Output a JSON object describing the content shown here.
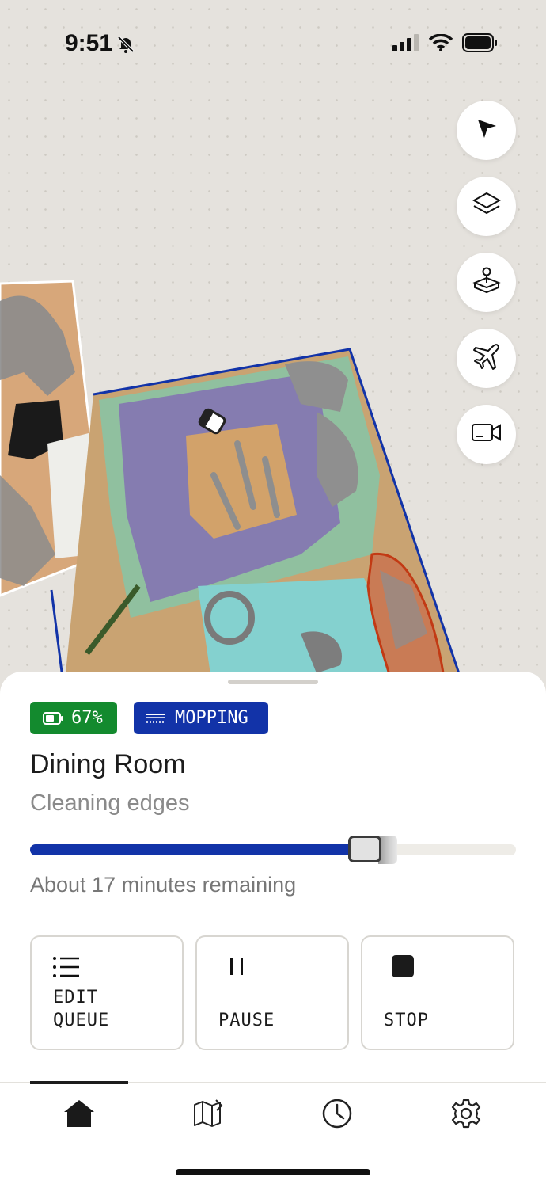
{
  "status_bar": {
    "time": "9:51"
  },
  "map_controls": [
    {
      "icon": "navigation-arrow-icon"
    },
    {
      "icon": "layers-icon"
    },
    {
      "icon": "joystick-icon"
    },
    {
      "icon": "airplane-icon"
    },
    {
      "icon": "video-camera-icon"
    }
  ],
  "cleaning": {
    "battery_label": "67%",
    "battery_percent": 67,
    "mode_label": "MOPPING",
    "room": "Dining Room",
    "phase": "Cleaning edges",
    "progress_fraction": 0.7,
    "remaining": "About 17 minutes remaining"
  },
  "actions": {
    "edit_queue": {
      "line1": "EDIT",
      "line2": "QUEUE"
    },
    "pause": "PAUSE",
    "stop": "STOP"
  },
  "tabs": [
    {
      "icon": "home-icon",
      "active": true
    },
    {
      "icon": "map-icon",
      "active": false
    },
    {
      "icon": "history-icon",
      "active": false
    },
    {
      "icon": "settings-icon",
      "active": false
    }
  ],
  "colors": {
    "accent": "#1233a8",
    "battery": "#138a2e",
    "edge_zone": "#c23a14"
  }
}
